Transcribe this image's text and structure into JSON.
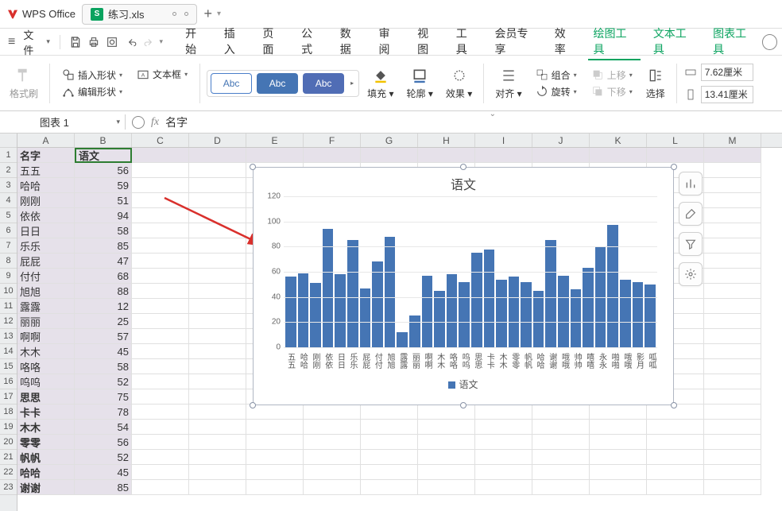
{
  "app": {
    "name": "WPS Office"
  },
  "tab": {
    "doc_name": "练习.xls",
    "plus": "+"
  },
  "menu": {
    "file": "文件",
    "items": [
      "开始",
      "插入",
      "页面",
      "公式",
      "数据",
      "审阅",
      "视图",
      "工具",
      "会员专享",
      "效率"
    ],
    "tools": [
      "绘图工具",
      "文本工具",
      "图表工具"
    ]
  },
  "ribbon": {
    "format_painter": "格式刷",
    "insert_shape": "插入形状",
    "text_box": "文本框",
    "edit_shape": "编辑形状",
    "abc": "Abc",
    "fill": "填充",
    "outline": "轮廓",
    "effect": "效果",
    "align": "对齐",
    "group": "组合",
    "rotate": "旋转",
    "bring_fwd": "上移",
    "send_back": "下移",
    "select": "选择",
    "width": "7.62厘米",
    "height": "13.41厘米"
  },
  "namebox": {
    "value": "图表 1"
  },
  "fx": {
    "value": "名字"
  },
  "columns": [
    "A",
    "B",
    "C",
    "D",
    "E",
    "F",
    "G",
    "H",
    "I",
    "J",
    "K",
    "L",
    "M"
  ],
  "header_row": {
    "A": "名字",
    "B": "语文"
  },
  "rows": [
    {
      "n": "2",
      "a": "五五",
      "b": "56"
    },
    {
      "n": "3",
      "a": "哈哈",
      "b": "59"
    },
    {
      "n": "4",
      "a": "刚刚",
      "b": "51"
    },
    {
      "n": "5",
      "a": "依依",
      "b": "94"
    },
    {
      "n": "6",
      "a": "日日",
      "b": "58"
    },
    {
      "n": "7",
      "a": "乐乐",
      "b": "85"
    },
    {
      "n": "8",
      "a": "屁屁",
      "b": "47"
    },
    {
      "n": "9",
      "a": "付付",
      "b": "68"
    },
    {
      "n": "10",
      "a": "旭旭",
      "b": "88"
    },
    {
      "n": "11",
      "a": "露露",
      "b": "12"
    },
    {
      "n": "12",
      "a": "丽丽",
      "b": "25"
    },
    {
      "n": "13",
      "a": "啊啊",
      "b": "57"
    },
    {
      "n": "14",
      "a": "木木",
      "b": "45"
    },
    {
      "n": "15",
      "a": "咯咯",
      "b": "58"
    },
    {
      "n": "16",
      "a": "呜呜",
      "b": "52"
    },
    {
      "n": "17",
      "a": "思思",
      "b": "75"
    },
    {
      "n": "18",
      "a": "卡卡",
      "b": "78"
    },
    {
      "n": "19",
      "a": "木木",
      "b": "54"
    },
    {
      "n": "20",
      "a": "零零",
      "b": "56"
    },
    {
      "n": "21",
      "a": "帆帆",
      "b": "52"
    },
    {
      "n": "22",
      "a": "哈哈",
      "b": "45"
    },
    {
      "n": "23",
      "a": "谢谢",
      "b": "85"
    }
  ],
  "chart_data": {
    "type": "bar",
    "title": "语文",
    "ylabel": "",
    "xlabel": "",
    "ylim": [
      0,
      120
    ],
    "yticks": [
      0,
      20,
      40,
      60,
      80,
      100,
      120
    ],
    "legend": "语文",
    "categories": [
      "五五",
      "哈哈",
      "刚刚",
      "依依",
      "日日",
      "乐乐",
      "屁屁",
      "付付",
      "旭旭",
      "露露",
      "丽丽",
      "啊啊",
      "木木",
      "咯咯",
      "呜呜",
      "思思",
      "卡卡",
      "木木",
      "零零",
      "帆帆",
      "哈哈",
      "谢谢",
      "哦哦",
      "帅帅",
      "嘻嘻",
      "永永",
      "啪啪",
      "哦哦",
      "影月",
      "呱呱"
    ],
    "values": [
      56,
      59,
      51,
      94,
      58,
      85,
      47,
      68,
      88,
      12,
      25,
      57,
      45,
      58,
      52,
      75,
      78,
      54,
      56,
      52,
      45,
      85,
      57,
      46,
      63,
      80,
      97,
      54,
      52,
      50
    ]
  },
  "float_icons": [
    "chart-style",
    "brush",
    "funnel",
    "gear"
  ]
}
